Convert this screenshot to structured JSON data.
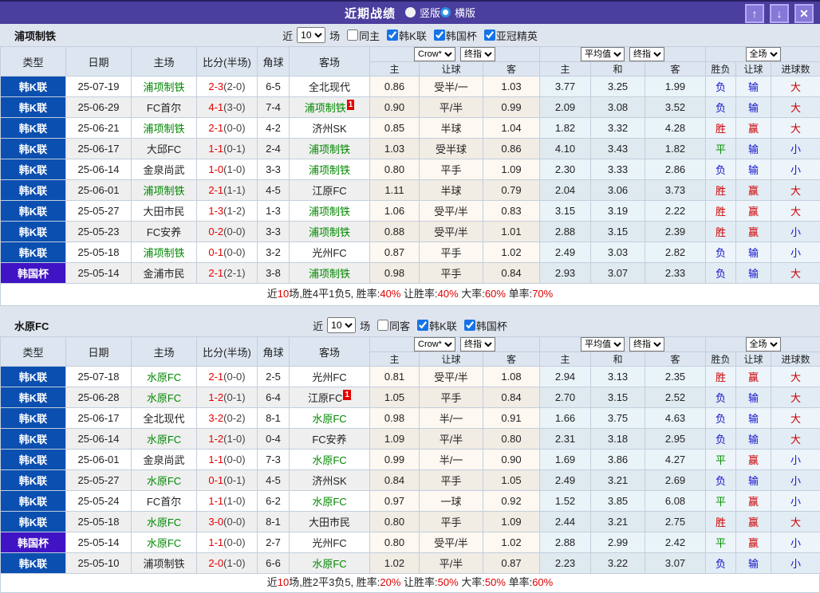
{
  "titlebar": {
    "title": "近期战绩",
    "radios": [
      {
        "label": "竖版",
        "selected": false
      },
      {
        "label": "横版",
        "selected": true
      }
    ],
    "buttons": [
      {
        "name": "move-up-button",
        "icon": "up-arrow-icon",
        "glyph": "↑"
      },
      {
        "name": "move-down-button",
        "icon": "down-arrow-icon",
        "glyph": "↓"
      },
      {
        "name": "close-button",
        "icon": "close-icon",
        "glyph": "✕"
      }
    ]
  },
  "colors": {
    "titlebar_bg": "#4a3e9e",
    "league_colors": {
      "韩K联": "#0b4fb0",
      "韩国杯": "#4013c4"
    },
    "result_colors": {
      "胜": "#cc0000",
      "赢": "#cc0000",
      "大": "#cc0000",
      "平": "#089000",
      "负": "#1414cc",
      "输": "#1414cc",
      "小": "#1414cc"
    },
    "self_team": "#008800",
    "score": "#e60000",
    "badge_bg": "#e30000"
  },
  "table_header": {
    "left_cols": [
      "类型",
      "日期",
      "主场",
      "比分(半场)",
      "角球",
      "客场"
    ],
    "selects": {
      "bookmaker": "Crow*",
      "bookmaker_stage": "终指",
      "average": "平均值",
      "average_stage": "终指",
      "scope": "全场"
    },
    "sub_cols": [
      "主",
      "让球",
      "客",
      "主",
      "和",
      "客",
      "胜负",
      "让球",
      "进球数"
    ]
  },
  "filter_common": {
    "near_label": "近",
    "near_value": "10",
    "games_label": "场"
  },
  "sections": [
    {
      "team": "浦项制铁",
      "filter": {
        "same_label": "同主",
        "same_checked": false,
        "leagues": [
          {
            "label": "韩K联",
            "checked": true
          },
          {
            "label": "韩国杯",
            "checked": true
          },
          {
            "label": "亚冠精英",
            "checked": true
          }
        ]
      },
      "rows": [
        {
          "league": "韩K联",
          "date": "25-07-19",
          "home": "浦项制铁",
          "home_self": true,
          "home_badge": "",
          "score": "2-3",
          "half": "(2-0)",
          "corner": "6-5",
          "away": "全北现代",
          "away_self": false,
          "away_badge": "",
          "o_home": "0.86",
          "o_line": "受半/一",
          "o_away": "1.03",
          "a_home": "3.77",
          "a_draw": "3.25",
          "a_away": "1.99",
          "r_wdl": "负",
          "r_let": "输",
          "r_goal": "大"
        },
        {
          "league": "韩K联",
          "date": "25-06-29",
          "home": "FC首尔",
          "home_self": false,
          "home_badge": "",
          "score": "4-1",
          "half": "(3-0)",
          "corner": "7-4",
          "away": "浦项制铁",
          "away_self": true,
          "away_badge": "1",
          "o_home": "0.90",
          "o_line": "平/半",
          "o_away": "0.99",
          "a_home": "2.09",
          "a_draw": "3.08",
          "a_away": "3.52",
          "r_wdl": "负",
          "r_let": "输",
          "r_goal": "大"
        },
        {
          "league": "韩K联",
          "date": "25-06-21",
          "home": "浦项制铁",
          "home_self": true,
          "home_badge": "",
          "score": "2-1",
          "half": "(0-0)",
          "corner": "4-2",
          "away": "济州SK",
          "away_self": false,
          "away_badge": "",
          "o_home": "0.85",
          "o_line": "半球",
          "o_away": "1.04",
          "a_home": "1.82",
          "a_draw": "3.32",
          "a_away": "4.28",
          "r_wdl": "胜",
          "r_let": "赢",
          "r_goal": "大"
        },
        {
          "league": "韩K联",
          "date": "25-06-17",
          "home": "大邱FC",
          "home_self": false,
          "home_badge": "",
          "score": "1-1",
          "half": "(0-1)",
          "corner": "2-4",
          "away": "浦项制铁",
          "away_self": true,
          "away_badge": "",
          "o_home": "1.03",
          "o_line": "受半球",
          "o_away": "0.86",
          "a_home": "4.10",
          "a_draw": "3.43",
          "a_away": "1.82",
          "r_wdl": "平",
          "r_let": "输",
          "r_goal": "小"
        },
        {
          "league": "韩K联",
          "date": "25-06-14",
          "home": "金泉尚武",
          "home_self": false,
          "home_badge": "",
          "score": "1-0",
          "half": "(1-0)",
          "corner": "3-3",
          "away": "浦项制铁",
          "away_self": true,
          "away_badge": "",
          "o_home": "0.80",
          "o_line": "平手",
          "o_away": "1.09",
          "a_home": "2.30",
          "a_draw": "3.33",
          "a_away": "2.86",
          "r_wdl": "负",
          "r_let": "输",
          "r_goal": "小"
        },
        {
          "league": "韩K联",
          "date": "25-06-01",
          "home": "浦项制铁",
          "home_self": true,
          "home_badge": "",
          "score": "2-1",
          "half": "(1-1)",
          "corner": "4-5",
          "away": "江原FC",
          "away_self": false,
          "away_badge": "",
          "o_home": "1.11",
          "o_line": "半球",
          "o_away": "0.79",
          "a_home": "2.04",
          "a_draw": "3.06",
          "a_away": "3.73",
          "r_wdl": "胜",
          "r_let": "赢",
          "r_goal": "大"
        },
        {
          "league": "韩K联",
          "date": "25-05-27",
          "home": "大田市民",
          "home_self": false,
          "home_badge": "",
          "score": "1-3",
          "half": "(1-2)",
          "corner": "1-3",
          "away": "浦项制铁",
          "away_self": true,
          "away_badge": "",
          "o_home": "1.06",
          "o_line": "受平/半",
          "o_away": "0.83",
          "a_home": "3.15",
          "a_draw": "3.19",
          "a_away": "2.22",
          "r_wdl": "胜",
          "r_let": "赢",
          "r_goal": "大"
        },
        {
          "league": "韩K联",
          "date": "25-05-23",
          "home": "FC安养",
          "home_self": false,
          "home_badge": "",
          "score": "0-2",
          "half": "(0-0)",
          "corner": "3-3",
          "away": "浦项制铁",
          "away_self": true,
          "away_badge": "",
          "o_home": "0.88",
          "o_line": "受平/半",
          "o_away": "1.01",
          "a_home": "2.88",
          "a_draw": "3.15",
          "a_away": "2.39",
          "r_wdl": "胜",
          "r_let": "赢",
          "r_goal": "小"
        },
        {
          "league": "韩K联",
          "date": "25-05-18",
          "home": "浦项制铁",
          "home_self": true,
          "home_badge": "",
          "score": "0-1",
          "half": "(0-0)",
          "corner": "3-2",
          "away": "光州FC",
          "away_self": false,
          "away_badge": "",
          "o_home": "0.87",
          "o_line": "平手",
          "o_away": "1.02",
          "a_home": "2.49",
          "a_draw": "3.03",
          "a_away": "2.82",
          "r_wdl": "负",
          "r_let": "输",
          "r_goal": "小"
        },
        {
          "league": "韩国杯",
          "date": "25-05-14",
          "home": "金浦市民",
          "home_self": false,
          "home_badge": "",
          "score": "2-1",
          "half": "(2-1)",
          "corner": "3-8",
          "away": "浦项制铁",
          "away_self": true,
          "away_badge": "",
          "o_home": "0.98",
          "o_line": "平手",
          "o_away": "0.84",
          "a_home": "2.93",
          "a_draw": "3.07",
          "a_away": "2.33",
          "r_wdl": "负",
          "r_let": "输",
          "r_goal": "大"
        }
      ],
      "summary_segments": [
        {
          "text": "近",
          "red": false
        },
        {
          "text": "10",
          "red": true
        },
        {
          "text": "场,胜4平1负5, 胜率:",
          "red": false
        },
        {
          "text": "40%",
          "red": true
        },
        {
          "text": " 让胜率:",
          "red": false
        },
        {
          "text": "40%",
          "red": true
        },
        {
          "text": " 大率:",
          "red": false
        },
        {
          "text": "60%",
          "red": true
        },
        {
          "text": " 单率:",
          "red": false
        },
        {
          "text": "70%",
          "red": true
        }
      ]
    },
    {
      "team": "水原FC",
      "filter": {
        "same_label": "同客",
        "same_checked": false,
        "leagues": [
          {
            "label": "韩K联",
            "checked": true
          },
          {
            "label": "韩国杯",
            "checked": true
          }
        ]
      },
      "rows": [
        {
          "league": "韩K联",
          "date": "25-07-18",
          "home": "水原FC",
          "home_self": true,
          "home_badge": "",
          "score": "2-1",
          "half": "(0-0)",
          "corner": "2-5",
          "away": "光州FC",
          "away_self": false,
          "away_badge": "",
          "o_home": "0.81",
          "o_line": "受平/半",
          "o_away": "1.08",
          "a_home": "2.94",
          "a_draw": "3.13",
          "a_away": "2.35",
          "r_wdl": "胜",
          "r_let": "赢",
          "r_goal": "大"
        },
        {
          "league": "韩K联",
          "date": "25-06-28",
          "home": "水原FC",
          "home_self": true,
          "home_badge": "",
          "score": "1-2",
          "half": "(0-1)",
          "corner": "6-4",
          "away": "江原FC",
          "away_self": false,
          "away_badge": "1",
          "o_home": "1.05",
          "o_line": "平手",
          "o_away": "0.84",
          "a_home": "2.70",
          "a_draw": "3.15",
          "a_away": "2.52",
          "r_wdl": "负",
          "r_let": "输",
          "r_goal": "大"
        },
        {
          "league": "韩K联",
          "date": "25-06-17",
          "home": "全北现代",
          "home_self": false,
          "home_badge": "",
          "score": "3-2",
          "half": "(0-2)",
          "corner": "8-1",
          "away": "水原FC",
          "away_self": true,
          "away_badge": "",
          "o_home": "0.98",
          "o_line": "半/一",
          "o_away": "0.91",
          "a_home": "1.66",
          "a_draw": "3.75",
          "a_away": "4.63",
          "r_wdl": "负",
          "r_let": "输",
          "r_goal": "大"
        },
        {
          "league": "韩K联",
          "date": "25-06-14",
          "home": "水原FC",
          "home_self": true,
          "home_badge": "",
          "score": "1-2",
          "half": "(1-0)",
          "corner": "0-4",
          "away": "FC安养",
          "away_self": false,
          "away_badge": "",
          "o_home": "1.09",
          "o_line": "平/半",
          "o_away": "0.80",
          "a_home": "2.31",
          "a_draw": "3.18",
          "a_away": "2.95",
          "r_wdl": "负",
          "r_let": "输",
          "r_goal": "大"
        },
        {
          "league": "韩K联",
          "date": "25-06-01",
          "home": "金泉尚武",
          "home_self": false,
          "home_badge": "",
          "score": "1-1",
          "half": "(0-0)",
          "corner": "7-3",
          "away": "水原FC",
          "away_self": true,
          "away_badge": "",
          "o_home": "0.99",
          "o_line": "半/一",
          "o_away": "0.90",
          "a_home": "1.69",
          "a_draw": "3.86",
          "a_away": "4.27",
          "r_wdl": "平",
          "r_let": "赢",
          "r_goal": "小"
        },
        {
          "league": "韩K联",
          "date": "25-05-27",
          "home": "水原FC",
          "home_self": true,
          "home_badge": "",
          "score": "0-1",
          "half": "(0-1)",
          "corner": "4-5",
          "away": "济州SK",
          "away_self": false,
          "away_badge": "",
          "o_home": "0.84",
          "o_line": "平手",
          "o_away": "1.05",
          "a_home": "2.49",
          "a_draw": "3.21",
          "a_away": "2.69",
          "r_wdl": "负",
          "r_let": "输",
          "r_goal": "小"
        },
        {
          "league": "韩K联",
          "date": "25-05-24",
          "home": "FC首尔",
          "home_self": false,
          "home_badge": "",
          "score": "1-1",
          "half": "(1-0)",
          "corner": "6-2",
          "away": "水原FC",
          "away_self": true,
          "away_badge": "",
          "o_home": "0.97",
          "o_line": "一球",
          "o_away": "0.92",
          "a_home": "1.52",
          "a_draw": "3.85",
          "a_away": "6.08",
          "r_wdl": "平",
          "r_let": "赢",
          "r_goal": "小"
        },
        {
          "league": "韩K联",
          "date": "25-05-18",
          "home": "水原FC",
          "home_self": true,
          "home_badge": "",
          "score": "3-0",
          "half": "(0-0)",
          "corner": "8-1",
          "away": "大田市民",
          "away_self": false,
          "away_badge": "",
          "o_home": "0.80",
          "o_line": "平手",
          "o_away": "1.09",
          "a_home": "2.44",
          "a_draw": "3.21",
          "a_away": "2.75",
          "r_wdl": "胜",
          "r_let": "赢",
          "r_goal": "大"
        },
        {
          "league": "韩国杯",
          "date": "25-05-14",
          "home": "水原FC",
          "home_self": true,
          "home_badge": "",
          "score": "1-1",
          "half": "(0-0)",
          "corner": "2-7",
          "away": "光州FC",
          "away_self": false,
          "away_badge": "",
          "o_home": "0.80",
          "o_line": "受平/半",
          "o_away": "1.02",
          "a_home": "2.88",
          "a_draw": "2.99",
          "a_away": "2.42",
          "r_wdl": "平",
          "r_let": "赢",
          "r_goal": "小"
        },
        {
          "league": "韩K联",
          "date": "25-05-10",
          "home": "浦项制铁",
          "home_self": false,
          "home_badge": "",
          "score": "2-0",
          "half": "(1-0)",
          "corner": "6-6",
          "away": "水原FC",
          "away_self": true,
          "away_badge": "",
          "o_home": "1.02",
          "o_line": "平/半",
          "o_away": "0.87",
          "a_home": "2.23",
          "a_draw": "3.22",
          "a_away": "3.07",
          "r_wdl": "负",
          "r_let": "输",
          "r_goal": "小"
        }
      ],
      "summary_segments": [
        {
          "text": "近",
          "red": false
        },
        {
          "text": "10",
          "red": true
        },
        {
          "text": "场,胜2平3负5, 胜率:",
          "red": false
        },
        {
          "text": "20%",
          "red": true
        },
        {
          "text": " 让胜率:",
          "red": false
        },
        {
          "text": "50%",
          "red": true
        },
        {
          "text": " 大率:",
          "red": false
        },
        {
          "text": "50%",
          "red": true
        },
        {
          "text": " 单率:",
          "red": false
        },
        {
          "text": "60%",
          "red": true
        }
      ]
    }
  ]
}
